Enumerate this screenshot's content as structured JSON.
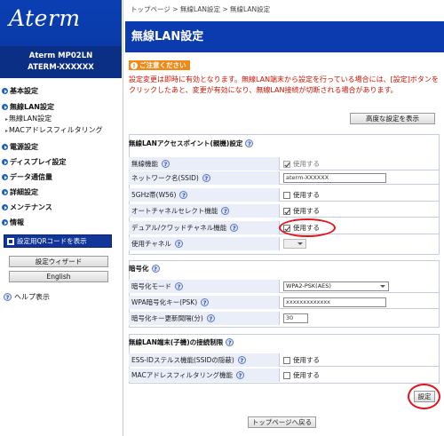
{
  "brand": {
    "logo": "Aterm",
    "model_line1": "Aterm   MP02LN",
    "model_line2": "ATERM-XXXXXX"
  },
  "sidebar": {
    "items": [
      {
        "label": "基本設定"
      },
      {
        "label": "無線LAN設定"
      },
      {
        "label": "無線LAN設定",
        "sub": true
      },
      {
        "label": "MACアドレスフィルタリング",
        "sub": true
      },
      {
        "label": "電源設定"
      },
      {
        "label": "ディスプレイ設定"
      },
      {
        "label": "データ通信量"
      },
      {
        "label": "詳細設定"
      },
      {
        "label": "メンテナンス"
      },
      {
        "label": "情報"
      }
    ],
    "qr_button": "設定用QRコードを表示",
    "wizard_button": "設定ウィザード",
    "english_button": "English",
    "help_label": "ヘルプ表示"
  },
  "main": {
    "breadcrumb": "トップページ > 無線LAN設定 > 無線LAN設定",
    "page_title": "無線LAN設定",
    "caution_badge": "ご注意ください",
    "caution_text": "設定変更は即時に有効となります。無線LAN端末から設定を行っている場合には、[設定]ボタンをクリックしたあと、変更が有効になり、無線LAN接続が切断される場合があります。",
    "advanced_button": "高度な設定を表示",
    "sections": {
      "ap": {
        "title": "無線LANアクセスポイント(親機)設定",
        "rows": [
          {
            "label": "無線機能",
            "value": "使用する",
            "checked": true
          },
          {
            "label": "ネットワーク名(SSID)",
            "value": "aterm-XXXXXX"
          },
          {
            "label": "5GHz帯(W56)",
            "value": "使用する",
            "checked": false
          },
          {
            "label": "オートチャネルセレクト機能",
            "value": "使用する",
            "checked": true
          },
          {
            "label": "デュアル/クワッドチャネル機能",
            "value": "使用する",
            "checked": true
          },
          {
            "label": "使用チャネル",
            "value": ""
          }
        ]
      },
      "enc": {
        "title": "暗号化",
        "rows": [
          {
            "label": "暗号化モード",
            "value": "WPA2-PSK(AES)"
          },
          {
            "label": "WPA暗号化キー(PSK)",
            "value": "xxxxxxxxxxxxx"
          },
          {
            "label": "暗号化キー更新間隔(分)",
            "value": "30"
          }
        ]
      },
      "limit": {
        "title": "無線LAN端末(子機)の接続制限",
        "rows": [
          {
            "label": "ESS-IDステルス機能(SSIDの隠蔽)",
            "value": "使用する",
            "checked": false
          },
          {
            "label": "MACアドレスフィルタリング機能",
            "value": "使用する",
            "checked": false
          }
        ]
      }
    },
    "set_button": "設定",
    "top_button": "トップページへ戻る"
  },
  "colors": {
    "brand_blue": "#0c3bb0",
    "caution_orange": "#f08a16",
    "alert_red": "#cc1100",
    "highlight_circle": "#e5121b"
  }
}
